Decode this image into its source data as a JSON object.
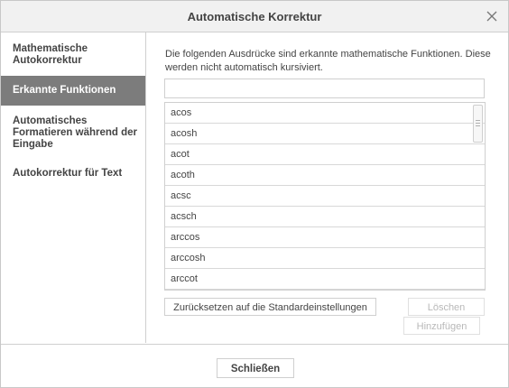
{
  "dialog": {
    "title": "Automatische Korrektur",
    "close_icon": "close-icon"
  },
  "sidebar": {
    "items": [
      {
        "label": "Mathematische Autokorrektur",
        "active": false
      },
      {
        "label": "Erkannte Funktionen",
        "active": true
      },
      {
        "label": "Automatisches Formatieren während der Eingabe",
        "active": false
      },
      {
        "label": "Autokorrektur für Text",
        "active": false
      }
    ]
  },
  "content": {
    "description": "Die folgenden Ausdrücke sind erkannte mathematische Funktionen. Diese werden nicht automatisch kursiviert.",
    "search": {
      "value": "",
      "placeholder": ""
    },
    "functions": [
      "acos",
      "acosh",
      "acot",
      "acoth",
      "acsc",
      "acsch",
      "arccos",
      "arccosh",
      "arccot"
    ],
    "reset_label": "Zurücksetzen auf die Standardeinstellungen",
    "delete_label": "Löschen",
    "add_label": "Hinzufügen"
  },
  "footer": {
    "close_label": "Schließen"
  },
  "colors": {
    "active_nav_bg": "#7c7c7c",
    "header_bg": "#f1f1f1",
    "border": "#cfcfcf"
  }
}
